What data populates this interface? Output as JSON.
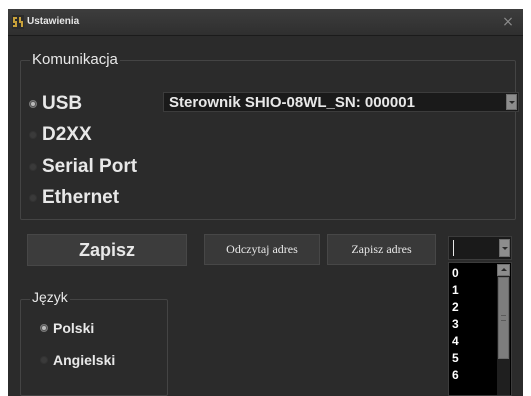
{
  "window": {
    "title": "Ustawienia",
    "close_symbol": "×",
    "icon": "app-logo-icon"
  },
  "communication": {
    "legend": "Komunikacja",
    "options": [
      {
        "label": "USB",
        "selected": true
      },
      {
        "label": "D2XX",
        "selected": false
      },
      {
        "label": "Serial Port",
        "selected": false
      },
      {
        "label": "Ethernet",
        "selected": false
      }
    ],
    "device_select": {
      "value": "Sterownik SHIO-08WL_SN: 000001"
    }
  },
  "actions": {
    "save_label": "Zapisz",
    "read_address_label": "Odczytaj adres",
    "save_address_label": "Zapisz adres"
  },
  "address": {
    "value": "",
    "options": [
      "0",
      "1",
      "2",
      "3",
      "4",
      "5",
      "6"
    ]
  },
  "language": {
    "legend": "Język",
    "options": [
      {
        "label": "Polski",
        "selected": true
      },
      {
        "label": "Angielski",
        "selected": false
      }
    ]
  },
  "colors": {
    "background": "#2b2b2b",
    "text": "#e8e8e8",
    "input_background": "#1a1a1a",
    "list_background": "#000000",
    "scroll_button": "#8d8d8d"
  }
}
